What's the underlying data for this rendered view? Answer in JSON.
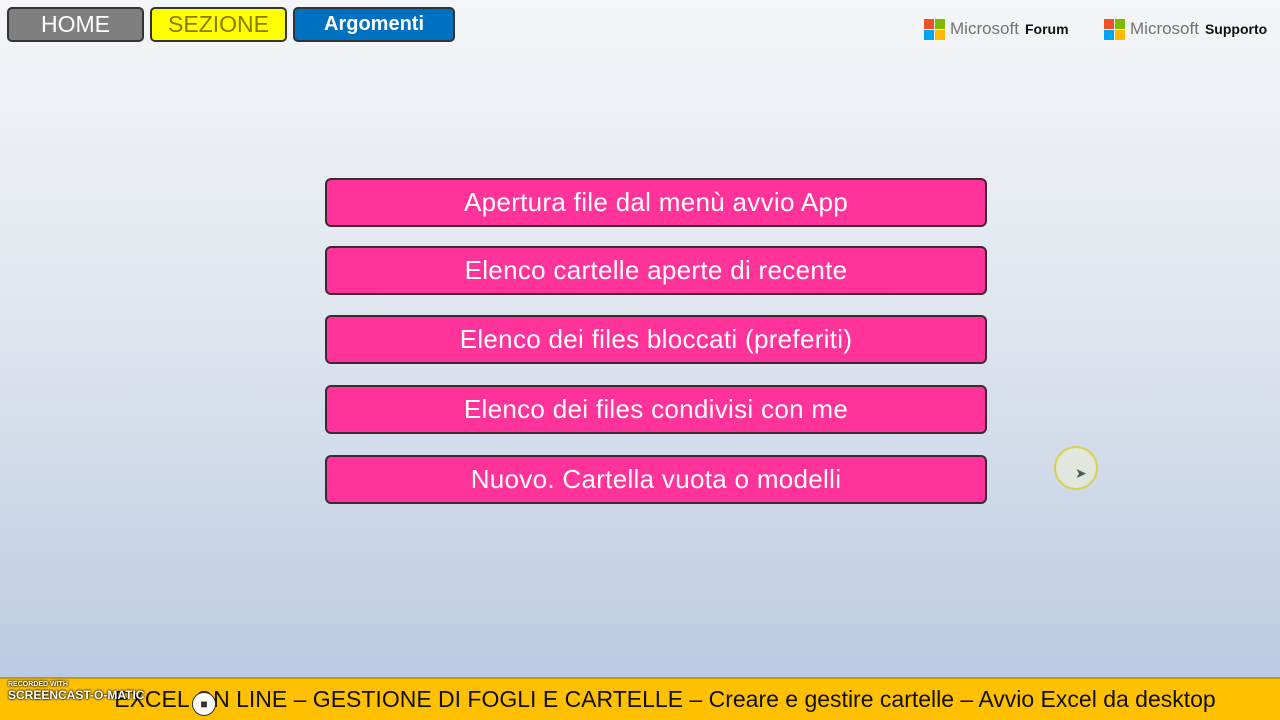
{
  "nav": {
    "home_label": "HOME",
    "sezione_label": "SEZIONE",
    "argomenti_label": "Argomenti"
  },
  "microsoft_links": [
    {
      "brand": "Microsoft",
      "label": "Forum"
    },
    {
      "brand": "Microsoft",
      "label": "Supporto"
    }
  ],
  "menu": {
    "items": [
      {
        "label": "Apertura file dal menù avvio App"
      },
      {
        "label": "Elenco cartelle aperte di recente"
      },
      {
        "label": "Elenco dei files bloccati (preferiti)"
      },
      {
        "label": "Elenco dei files condivisi con me"
      },
      {
        "label": "Nuovo. Cartella vuota o modelli"
      }
    ]
  },
  "footer": {
    "text": "EXCEL ON LINE – GESTIONE DI FOGLI E CARTELLE – Creare e gestire cartelle – Avvio Excel da desktop"
  },
  "watermark": {
    "top": "RECORDED WITH",
    "main": "SCREENCAST-O-MATIC"
  },
  "colors": {
    "menu_button": "#ff3399",
    "home": "#7f7f7f",
    "sezione": "#ffff00",
    "argomenti": "#0070c0",
    "footer": "#ffc000",
    "ms_red": "#f25022",
    "ms_green": "#7fba00",
    "ms_blue": "#00a4ef",
    "ms_yellow": "#ffb900"
  }
}
